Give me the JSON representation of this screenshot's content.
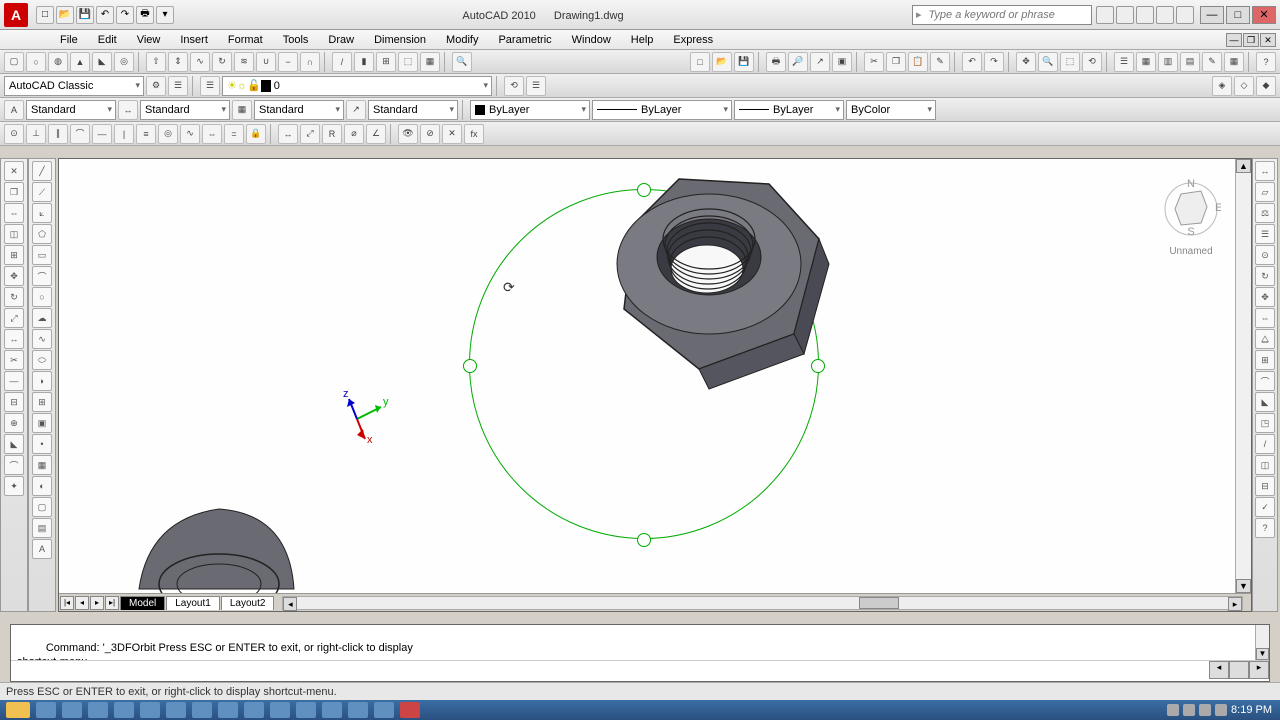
{
  "title": {
    "app": "AutoCAD 2010",
    "doc": "Drawing1.dwg"
  },
  "search": {
    "placeholder": "Type a keyword or phrase"
  },
  "menu": [
    "File",
    "Edit",
    "View",
    "Insert",
    "Format",
    "Tools",
    "Draw",
    "Dimension",
    "Modify",
    "Parametric",
    "Window",
    "Help",
    "Express"
  ],
  "workspace": {
    "name": "AutoCAD Classic"
  },
  "layer": {
    "current": "0"
  },
  "styles": {
    "text": "Standard",
    "dim": "Standard",
    "table": "Standard",
    "mleader": "Standard"
  },
  "props": {
    "color": "ByLayer",
    "ltype": "ByLayer",
    "lweight": "ByLayer",
    "plot": "ByColor"
  },
  "viewcube": {
    "view": "Unnamed"
  },
  "tabs": {
    "model": "Model",
    "layout1": "Layout1",
    "layout2": "Layout2"
  },
  "command": {
    "history": "Command: '_3DFOrbit Press ESC or ENTER to exit, or right-click to display\nshortcut-menu.",
    "input": ""
  },
  "status": "Press ESC or ENTER to exit, or right-click to display shortcut-menu.",
  "ucs": {
    "x": "x",
    "y": "y",
    "z": "z"
  },
  "clock": "8:19 PM",
  "chart_data": null
}
